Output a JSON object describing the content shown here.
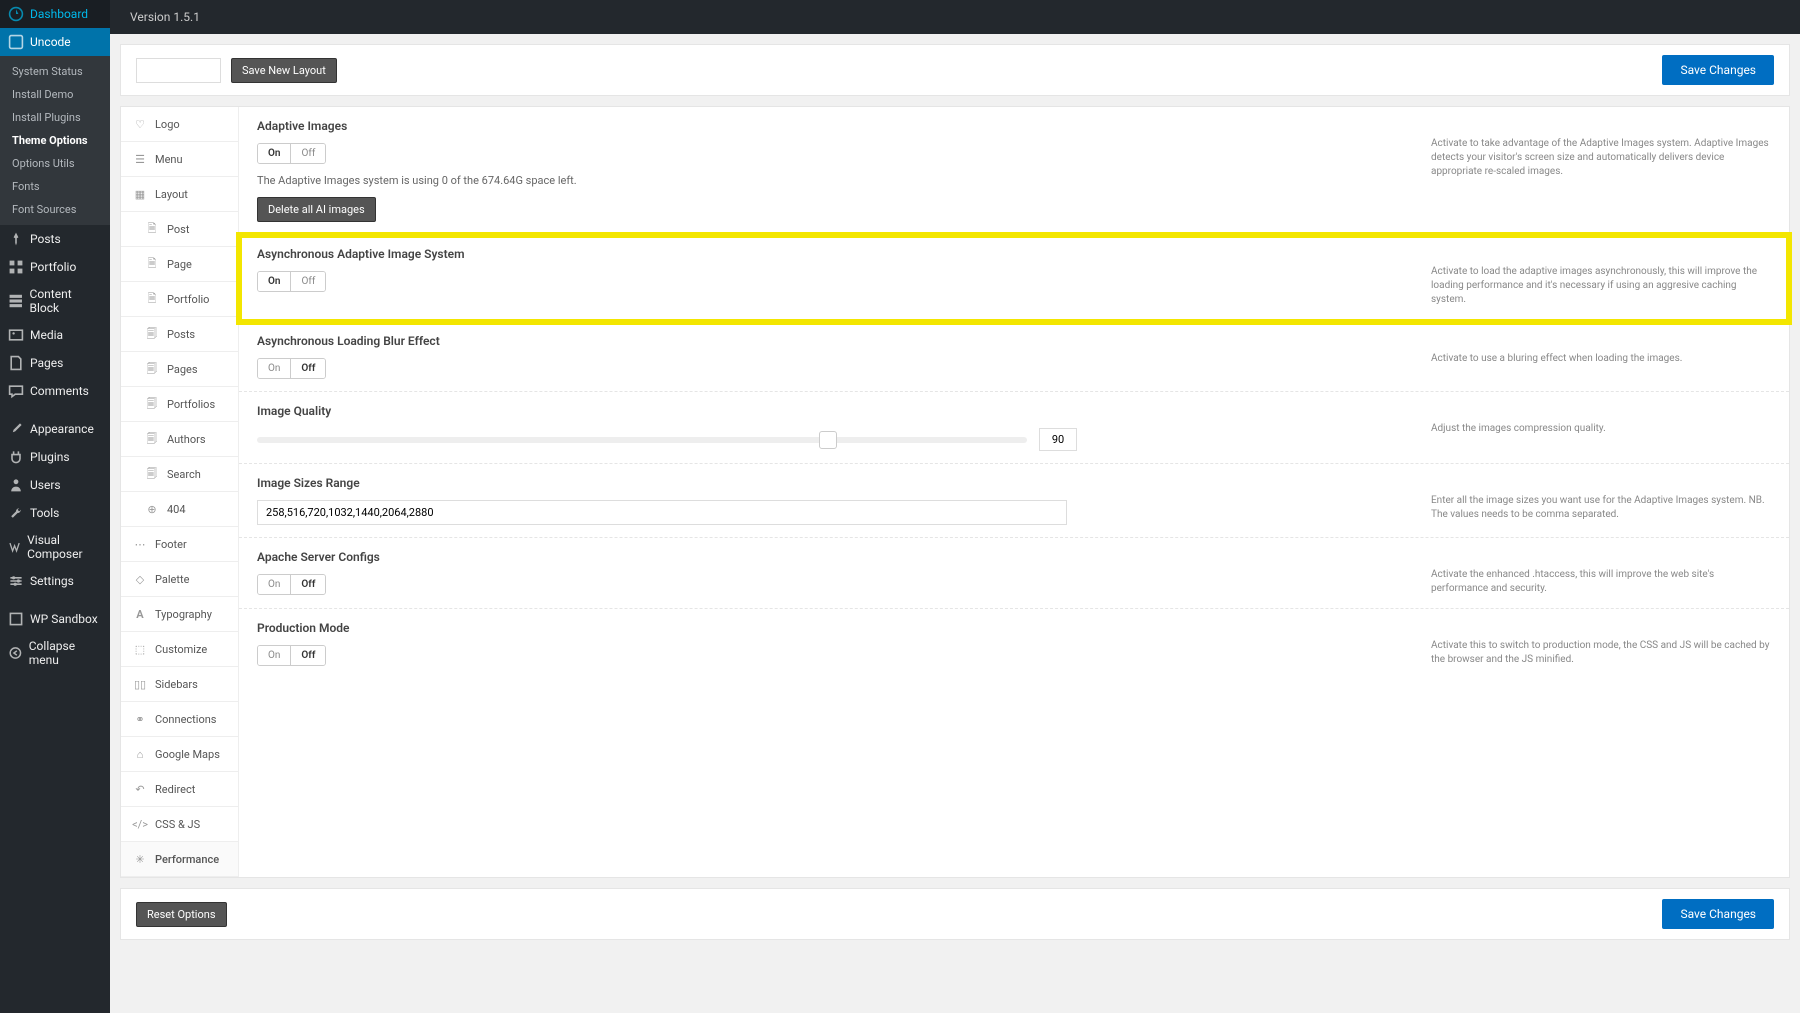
{
  "topbar": {
    "version": "Version 1.5.1"
  },
  "layout_header": {
    "input_value": "",
    "save_new_layout": "Save New Layout",
    "save_changes": "Save Changes"
  },
  "wp_menu": {
    "dashboard": "Dashboard",
    "uncode": "Uncode",
    "uncode_sub": {
      "system_status": "System Status",
      "install_demo": "Install Demo",
      "install_plugins": "Install Plugins",
      "theme_options": "Theme Options",
      "options_utils": "Options Utils",
      "fonts": "Fonts",
      "font_sources": "Font Sources"
    },
    "posts": "Posts",
    "portfolio": "Portfolio",
    "content_block": "Content Block",
    "media": "Media",
    "pages": "Pages",
    "comments": "Comments",
    "appearance": "Appearance",
    "plugins": "Plugins",
    "users": "Users",
    "tools": "Tools",
    "visual_composer": "Visual Composer",
    "settings": "Settings",
    "wp_sandbox": "WP Sandbox",
    "collapse": "Collapse menu"
  },
  "tabs": {
    "logo": "Logo",
    "menu": "Menu",
    "layout": "Layout",
    "layout_sub": {
      "post_detail": "Post",
      "page_detail": "Page",
      "portfolio_detail": "Portfolio",
      "posts": "Posts",
      "pages": "Pages",
      "portfolios": "Portfolios",
      "authors": "Authors",
      "search": "Search",
      "404": "404"
    },
    "footer": "Footer",
    "palette": "Palette",
    "typography": "Typography",
    "customize": "Customize",
    "sidebars": "Sidebars",
    "connections": "Connections",
    "google_maps": "Google Maps",
    "redirect": "Redirect",
    "css_js": "CSS & JS",
    "performance": "Performance"
  },
  "settings": {
    "adaptive_images": {
      "title": "Adaptive Images",
      "on": "On",
      "off": "Off",
      "desc": "The Adaptive Images system is using 0 of the 674.64G space left.",
      "delete_btn": "Delete all AI images",
      "help": "Activate to take advantage of the Adaptive Images system. Adaptive Images detects your visitor's screen size and automatically delivers device appropriate re-scaled images."
    },
    "async_adaptive": {
      "title": "Asynchronous Adaptive Image System",
      "on": "On",
      "off": "Off",
      "help": "Activate to load the adaptive images asynchronously, this will improve the loading performance and it's necessary if using an aggresive caching system."
    },
    "blur_effect": {
      "title": "Asynchronous Loading Blur Effect",
      "on": "On",
      "off": "Off",
      "help": "Activate to use a bluring effect when loading the images."
    },
    "image_quality": {
      "title": "Image Quality",
      "value": "90",
      "help": "Adjust the images compression quality."
    },
    "image_sizes": {
      "title": "Image Sizes Range",
      "value": "258,516,720,1032,1440,2064,2880",
      "help": "Enter all the image sizes you want use for the Adaptive Images system. NB. The values needs to be comma separated."
    },
    "apache": {
      "title": "Apache Server Configs",
      "on": "On",
      "off": "Off",
      "help": "Activate the enhanced .htaccess, this will improve the web site's performance and security."
    },
    "production": {
      "title": "Production Mode",
      "on": "On",
      "off": "Off",
      "help": "Activate this to switch to production mode, the CSS and JS will be cached by the browser and the JS minified."
    }
  },
  "footer": {
    "reset": "Reset Options",
    "save_changes": "Save Changes"
  }
}
